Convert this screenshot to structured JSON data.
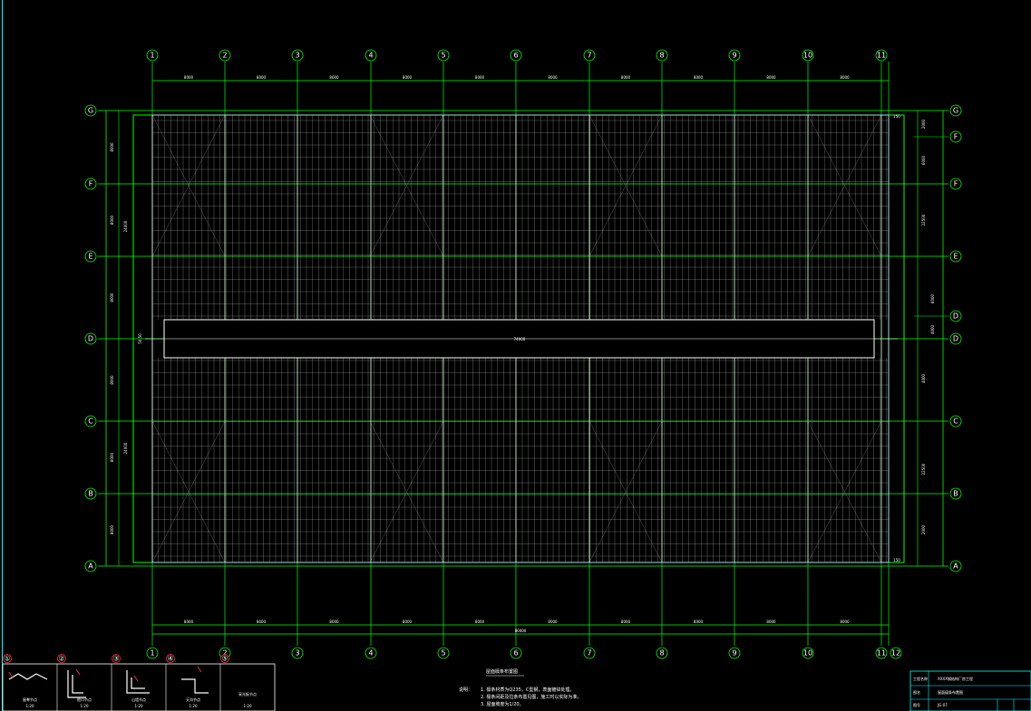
{
  "drawing": {
    "background": "#000000",
    "grid_color": "#00ff00",
    "purlin_color": "#c8c8c8",
    "border_color": "#00ffff",
    "dim_color": "#00ff00"
  },
  "axes": {
    "columns_top": [
      "1",
      "2",
      "3",
      "4",
      "5",
      "6",
      "7",
      "8",
      "9",
      "10",
      "11"
    ],
    "columns_bottom": [
      "1",
      "2",
      "3",
      "4",
      "5",
      "6",
      "7",
      "8",
      "9",
      "10",
      "11",
      "12"
    ],
    "rows_left": [
      "G",
      "F",
      "E",
      "D",
      "C",
      "B",
      "A"
    ],
    "rows_right": [
      "G",
      "F",
      "E",
      "D",
      "C",
      "B",
      "A"
    ],
    "rows_right_extra": [
      "F",
      "D"
    ]
  },
  "dimensions": {
    "top_spans": [
      "8000",
      "8000",
      "8000",
      "8000",
      "8000",
      "8000",
      "8000",
      "8000",
      "8000",
      "8000"
    ],
    "bottom_spans": [
      "8000",
      "8000",
      "8000",
      "8000",
      "8000",
      "8000",
      "8000",
      "8000",
      "8000",
      "8000"
    ],
    "bottom_total": "80000",
    "left_spans": [
      "8000",
      "8000",
      "8000",
      "8000",
      "8000",
      "8000"
    ],
    "left_totals": [
      "24000",
      "24000"
    ],
    "center_label": "74000",
    "center_left": "50 50",
    "right_spans": [
      "2000",
      "6000",
      "22500",
      "6000",
      "4000",
      "4000",
      "22500",
      "2000"
    ],
    "right_edge_top": "150",
    "right_edge_bottom": "150"
  },
  "detail_markers": [
    "①",
    "②",
    "③",
    "④",
    "⑤"
  ],
  "details": [
    {
      "caption": "屋脊节点",
      "scale": "1:20"
    },
    {
      "caption": "檐口节点",
      "scale": "1:20"
    },
    {
      "caption": "山墙节点",
      "scale": "1:20"
    },
    {
      "caption": "天沟节点",
      "scale": "1:20"
    },
    {
      "caption": "采光板节点",
      "scale": "1:20"
    }
  ],
  "notes": {
    "title": "屋面檩条布置图",
    "prefix": "说明：",
    "lines": [
      "1. 檩条材质为Q235，C型钢，表面镀锌处理。",
      "2. 檩条间距及拉条布置见图，施工时以实际为准。",
      "3. 屋面坡度为1/20。"
    ]
  },
  "title_block": {
    "row1_label": "工程名称",
    "row1_value": "XXXX钢结构厂房工程",
    "row2_label": "图名",
    "row2_value": "屋面檩条布置图",
    "row3_label": "图号",
    "row3_value": "JG-07"
  }
}
